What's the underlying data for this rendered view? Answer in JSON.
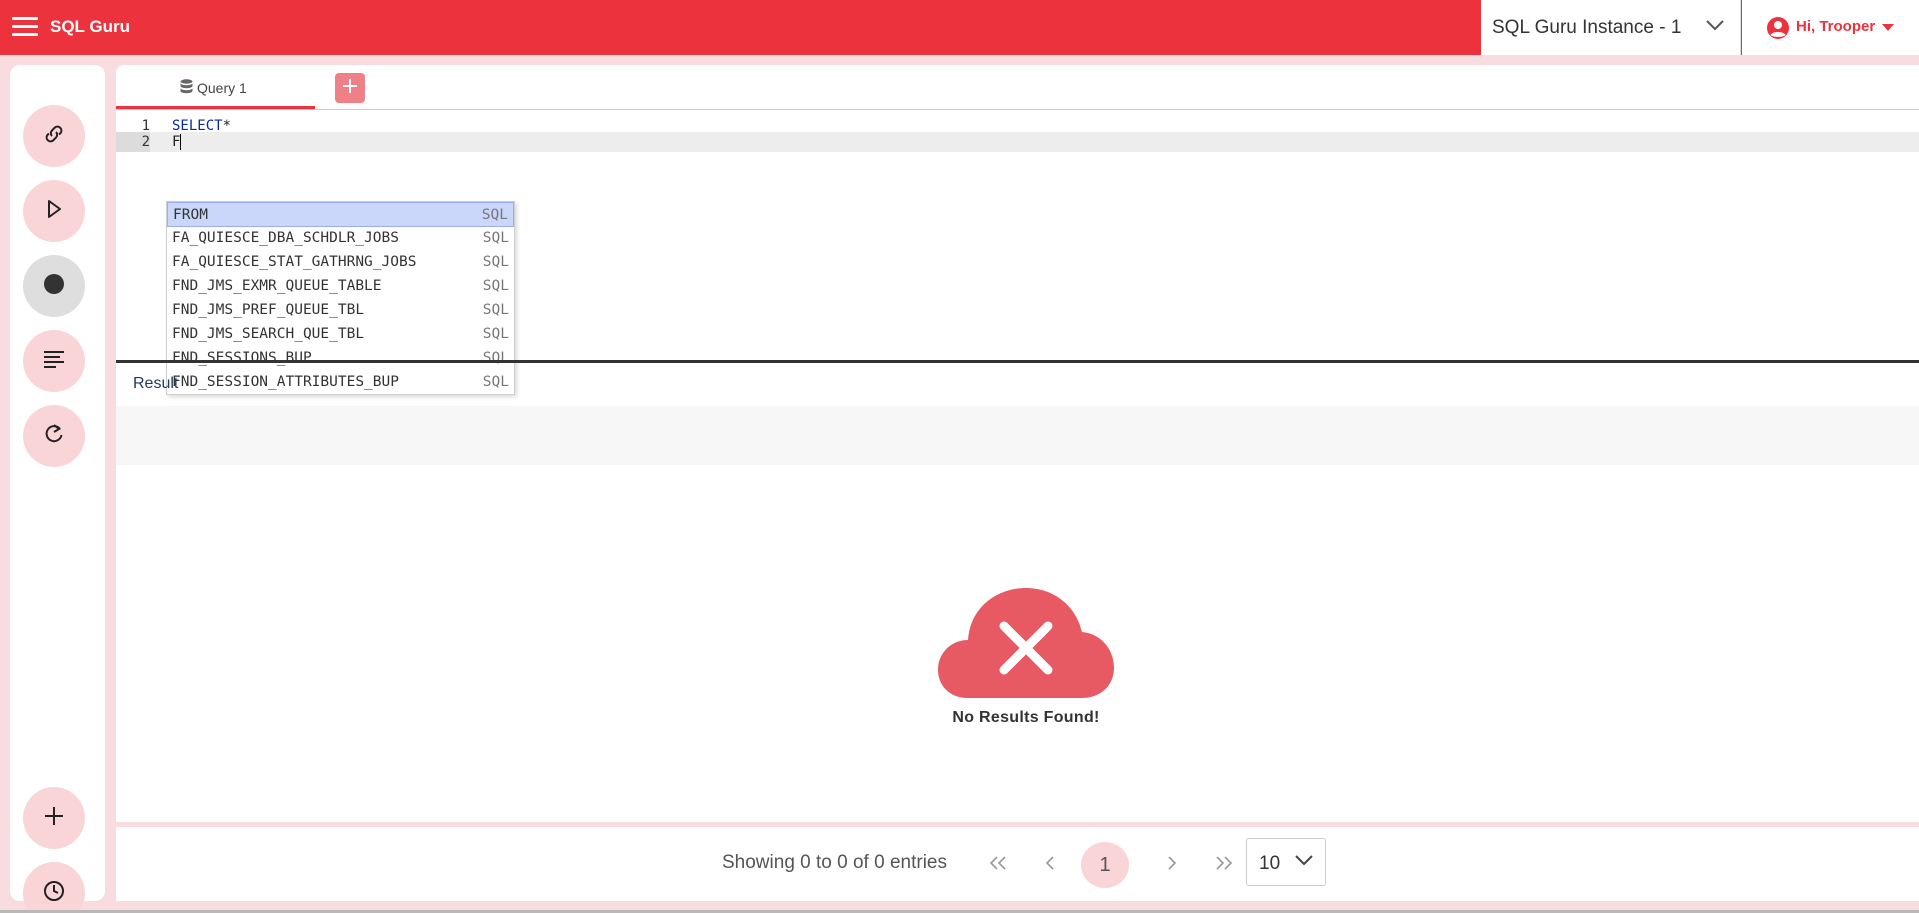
{
  "header": {
    "app_title": "SQL Guru",
    "instance": "SQL Guru Instance - 1",
    "user_greeting": "Hi, Trooper",
    "brand_color": "#ec323c"
  },
  "sidebar": {
    "buttons": [
      {
        "name": "connect",
        "icon": "link-icon"
      },
      {
        "name": "run",
        "icon": "play-icon"
      },
      {
        "name": "stop",
        "icon": "record-icon",
        "disabled": true
      },
      {
        "name": "format",
        "icon": "align-left-icon"
      },
      {
        "name": "refresh",
        "icon": "refresh-icon"
      },
      {
        "name": "add",
        "icon": "plus-icon"
      },
      {
        "name": "history",
        "icon": "clock-icon"
      }
    ]
  },
  "tabs": [
    {
      "label": "Query 1",
      "icon": "database-icon",
      "active": true
    }
  ],
  "editor": {
    "lines": [
      {
        "number": "1",
        "keyword": "SELECT",
        "rest": "*"
      },
      {
        "number": "2",
        "text": "F"
      }
    ]
  },
  "autocomplete": {
    "items": [
      {
        "label": "FROM",
        "meta": "SQL"
      },
      {
        "label": "FA_QUIESCE_DBA_SCHDLR_JOBS",
        "meta": "SQL"
      },
      {
        "label": "FA_QUIESCE_STAT_GATHRNG_JOBS",
        "meta": "SQL"
      },
      {
        "label": "FND_JMS_EXMR_QUEUE_TABLE",
        "meta": "SQL"
      },
      {
        "label": "FND_JMS_PREF_QUEUE_TBL",
        "meta": "SQL"
      },
      {
        "label": "FND_JMS_SEARCH_QUE_TBL",
        "meta": "SQL"
      },
      {
        "label": "FND_SESSIONS_BUP",
        "meta": "SQL"
      },
      {
        "label": "FND_SESSION_ATTRIBUTES_BUP",
        "meta": "SQL"
      }
    ]
  },
  "result": {
    "title": "Result",
    "empty_message": "No Results Found!"
  },
  "pagination": {
    "entries_text": "Showing 0 to 0 of 0 entries",
    "first": "«",
    "prev": "‹",
    "current_page": "1",
    "next": "›",
    "last": "»",
    "page_size": "10"
  }
}
